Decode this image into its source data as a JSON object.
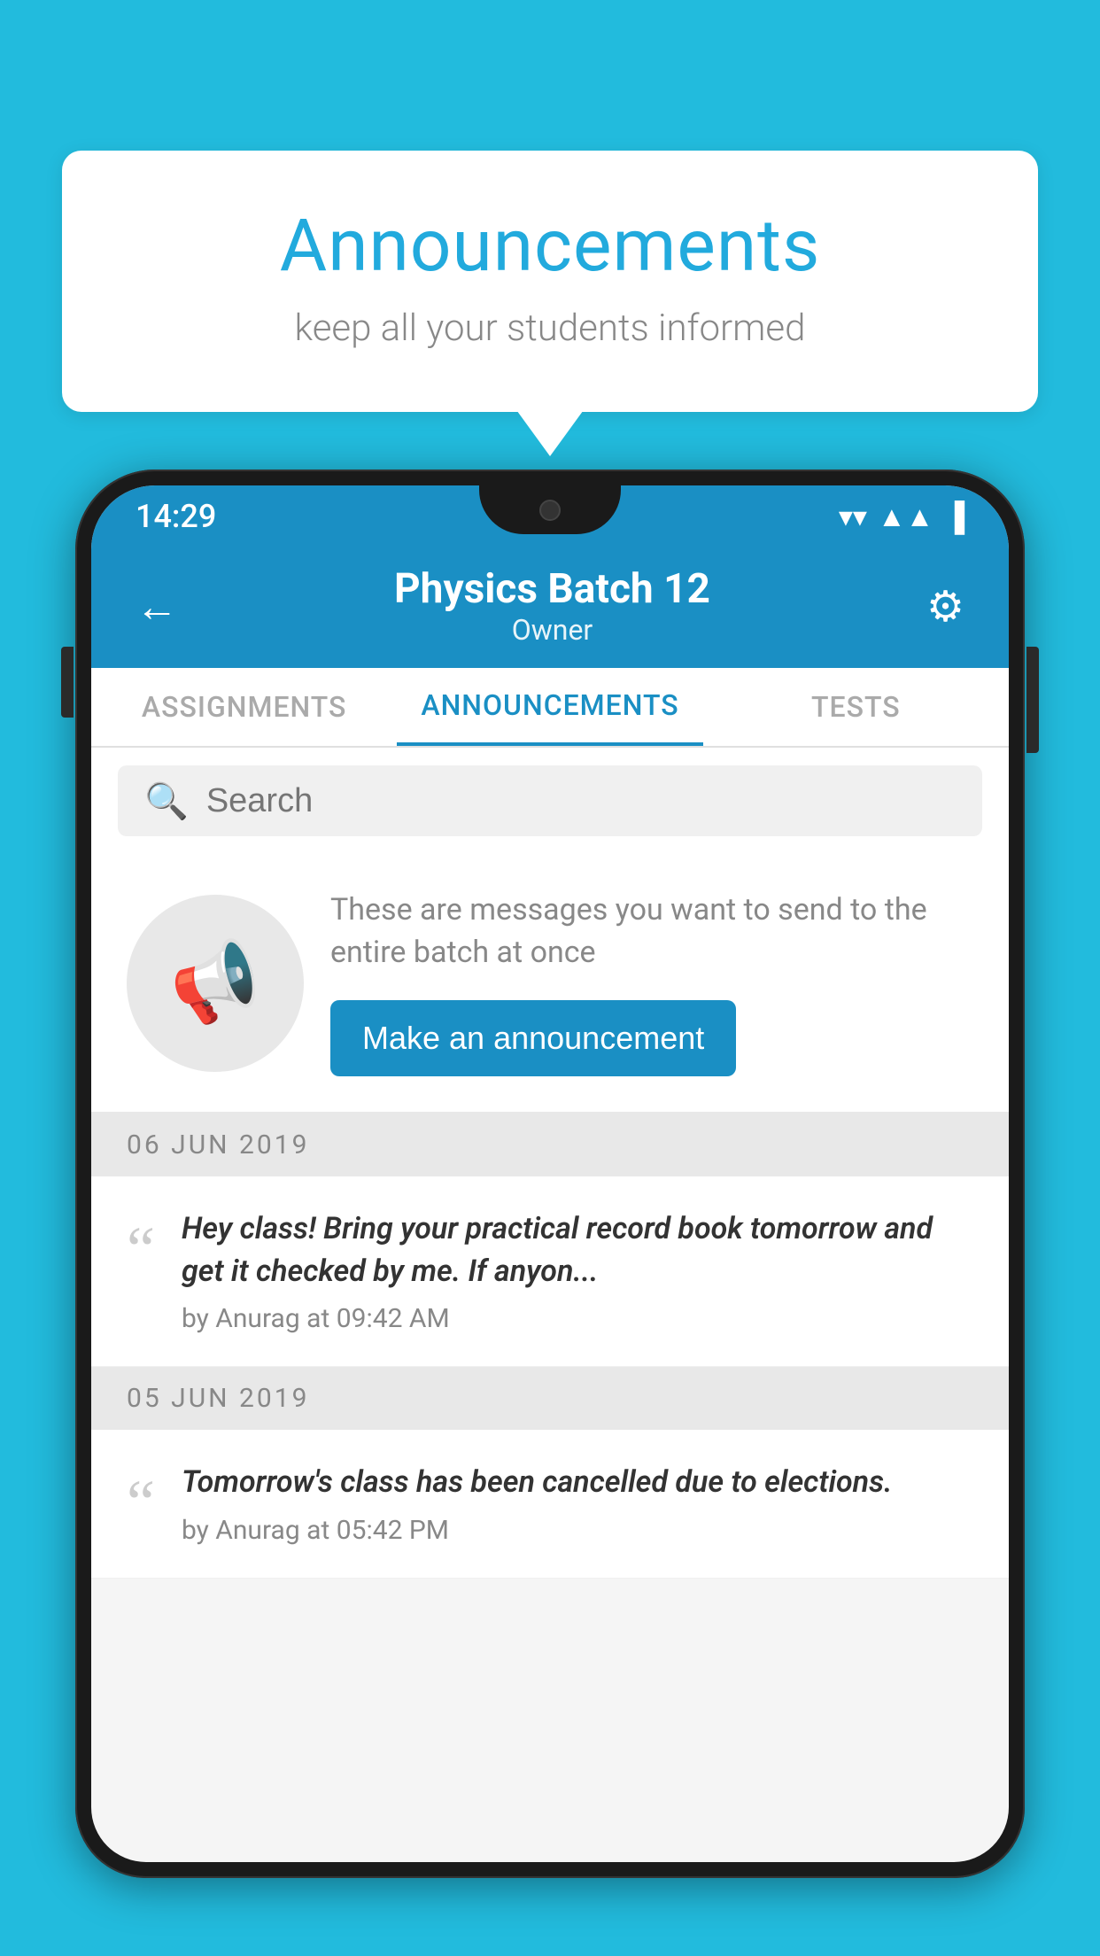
{
  "page": {
    "background_color": "#22BBDD"
  },
  "speech_bubble": {
    "title": "Announcements",
    "subtitle": "keep all your students informed"
  },
  "status_bar": {
    "time": "14:29",
    "wifi": "▼",
    "signal": "▲",
    "battery": "▮"
  },
  "header": {
    "back_label": "←",
    "title": "Physics Batch 12",
    "subtitle": "Owner",
    "gear_label": "⚙"
  },
  "tabs": [
    {
      "label": "ASSIGNMENTS",
      "active": false
    },
    {
      "label": "ANNOUNCEMENTS",
      "active": true
    },
    {
      "label": "TESTS",
      "active": false
    }
  ],
  "search": {
    "placeholder": "Search"
  },
  "promo": {
    "description": "These are messages you want to send to the entire batch at once",
    "button_label": "Make an announcement"
  },
  "announcements": [
    {
      "date": "06  JUN  2019",
      "text": "Hey class! Bring your practical record book tomorrow and get it checked by me. If anyon...",
      "meta": "by Anurag at 09:42 AM"
    },
    {
      "date": "05  JUN  2019",
      "text": "Tomorrow's class has been cancelled due to elections.",
      "meta": "by Anurag at 05:42 PM"
    }
  ]
}
